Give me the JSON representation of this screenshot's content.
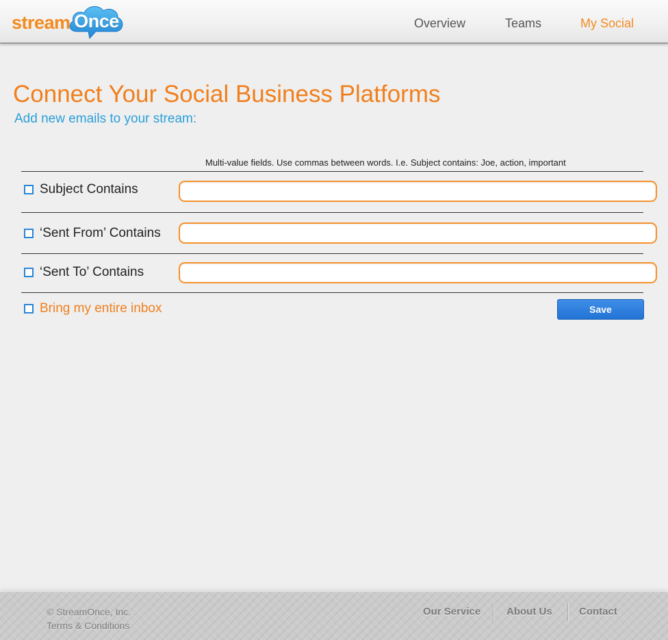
{
  "brand": {
    "logo_part1": "stream",
    "logo_part2": "Once",
    "logo_color_orange": "#f28b20",
    "logo_color_blue": "#2a9be0"
  },
  "nav": {
    "items": [
      {
        "label": "Overview",
        "active": false
      },
      {
        "label": "Teams",
        "active": false
      },
      {
        "label": "My Social",
        "active": true
      }
    ],
    "active_color": "#f28b20"
  },
  "page": {
    "title": "Connect Your Social Business Platforms",
    "subtitle": "Add new emails to your stream:"
  },
  "form": {
    "hint": "Multi-value fields. Use commas between words. I.e. Subject contains: Joe, action, important",
    "rows": [
      {
        "label": "Subject Contains",
        "checked": false,
        "value": ""
      },
      {
        "label": "‘Sent From’ Contains",
        "checked": false,
        "value": ""
      },
      {
        "label": "‘Sent To’ Contains",
        "checked": false,
        "value": ""
      }
    ],
    "bring_inbox": {
      "label": "Bring my entire inbox",
      "checked": false
    },
    "save_label": "Save",
    "field_border_color": "#f5902b",
    "checkbox_color": "#2a84d6",
    "button_color": "#2a7de0"
  },
  "footer": {
    "copyright": "© StreamOnce, Inc.",
    "terms": "Terms & Conditions",
    "links": [
      {
        "label": "Our Service"
      },
      {
        "label": "About Us"
      },
      {
        "label": "Contact"
      }
    ]
  }
}
